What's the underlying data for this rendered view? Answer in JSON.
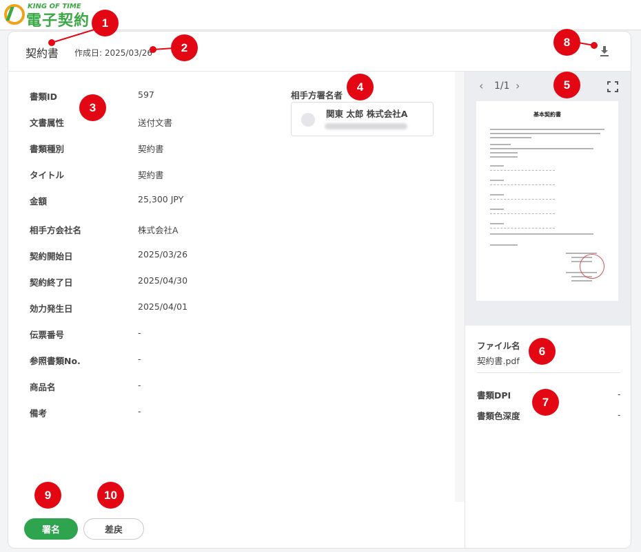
{
  "app": {
    "logo_small": "KING OF TIME",
    "logo_big": "電子契約"
  },
  "header": {
    "title": "契約書",
    "created": "作成日: 2025/03/26"
  },
  "fields": [
    {
      "label": "書類ID",
      "value": "597"
    },
    {
      "label": "文書属性",
      "value": "送付文書"
    },
    {
      "label": "書類種別",
      "value": "契約書"
    },
    {
      "label": "タイトル",
      "value": "契約書"
    },
    {
      "label": "金額",
      "value": "25,300 JPY"
    },
    {
      "label": "相手方会社名",
      "value": "株式会社A"
    },
    {
      "label": "契約開始日",
      "value": "2025/03/26"
    },
    {
      "label": "契約終了日",
      "value": "2025/04/30"
    },
    {
      "label": "効力発生日",
      "value": "2025/04/01"
    },
    {
      "label": "伝票番号",
      "value": "-"
    },
    {
      "label": "参照書類No.",
      "value": "-"
    },
    {
      "label": "商品名",
      "value": "-"
    },
    {
      "label": "備考",
      "value": "-"
    }
  ],
  "counterparty": {
    "label": "相手方署名者",
    "name": "関東 太郎 株式会社A"
  },
  "preview": {
    "prev": "‹",
    "page": "1/1",
    "next": "›",
    "paper_title": "基本契約書"
  },
  "file": {
    "label": "ファイル名",
    "name": "契約書.pdf"
  },
  "meta": [
    {
      "label": "書類DPI",
      "value": "-"
    },
    {
      "label": "書類色深度",
      "value": "-"
    }
  ],
  "actions": {
    "sign": "署名",
    "return": "差戻"
  },
  "badges": [
    "1",
    "2",
    "3",
    "4",
    "5",
    "6",
    "7",
    "8",
    "9",
    "10"
  ],
  "colors": {
    "accent_green": "#2ea44f",
    "badge_red": "#e30613",
    "logo_orange": "#f0a21b"
  }
}
